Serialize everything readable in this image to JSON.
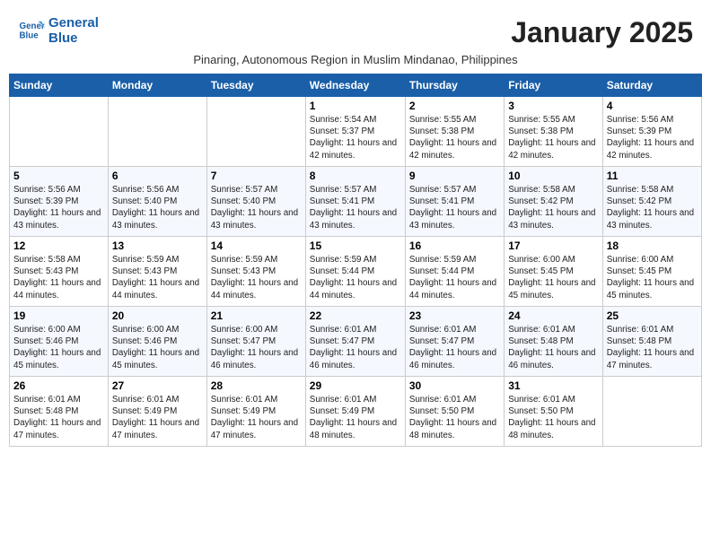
{
  "header": {
    "logo_line1": "General",
    "logo_line2": "Blue",
    "month_title": "January 2025",
    "subtitle": "Pinaring, Autonomous Region in Muslim Mindanao, Philippines"
  },
  "weekdays": [
    "Sunday",
    "Monday",
    "Tuesday",
    "Wednesday",
    "Thursday",
    "Friday",
    "Saturday"
  ],
  "weeks": [
    [
      {
        "day": "",
        "sunrise": "",
        "sunset": "",
        "daylight": ""
      },
      {
        "day": "",
        "sunrise": "",
        "sunset": "",
        "daylight": ""
      },
      {
        "day": "",
        "sunrise": "",
        "sunset": "",
        "daylight": ""
      },
      {
        "day": "1",
        "sunrise": "Sunrise: 5:54 AM",
        "sunset": "Sunset: 5:37 PM",
        "daylight": "Daylight: 11 hours and 42 minutes."
      },
      {
        "day": "2",
        "sunrise": "Sunrise: 5:55 AM",
        "sunset": "Sunset: 5:38 PM",
        "daylight": "Daylight: 11 hours and 42 minutes."
      },
      {
        "day": "3",
        "sunrise": "Sunrise: 5:55 AM",
        "sunset": "Sunset: 5:38 PM",
        "daylight": "Daylight: 11 hours and 42 minutes."
      },
      {
        "day": "4",
        "sunrise": "Sunrise: 5:56 AM",
        "sunset": "Sunset: 5:39 PM",
        "daylight": "Daylight: 11 hours and 42 minutes."
      }
    ],
    [
      {
        "day": "5",
        "sunrise": "Sunrise: 5:56 AM",
        "sunset": "Sunset: 5:39 PM",
        "daylight": "Daylight: 11 hours and 43 minutes."
      },
      {
        "day": "6",
        "sunrise": "Sunrise: 5:56 AM",
        "sunset": "Sunset: 5:40 PM",
        "daylight": "Daylight: 11 hours and 43 minutes."
      },
      {
        "day": "7",
        "sunrise": "Sunrise: 5:57 AM",
        "sunset": "Sunset: 5:40 PM",
        "daylight": "Daylight: 11 hours and 43 minutes."
      },
      {
        "day": "8",
        "sunrise": "Sunrise: 5:57 AM",
        "sunset": "Sunset: 5:41 PM",
        "daylight": "Daylight: 11 hours and 43 minutes."
      },
      {
        "day": "9",
        "sunrise": "Sunrise: 5:57 AM",
        "sunset": "Sunset: 5:41 PM",
        "daylight": "Daylight: 11 hours and 43 minutes."
      },
      {
        "day": "10",
        "sunrise": "Sunrise: 5:58 AM",
        "sunset": "Sunset: 5:42 PM",
        "daylight": "Daylight: 11 hours and 43 minutes."
      },
      {
        "day": "11",
        "sunrise": "Sunrise: 5:58 AM",
        "sunset": "Sunset: 5:42 PM",
        "daylight": "Daylight: 11 hours and 43 minutes."
      }
    ],
    [
      {
        "day": "12",
        "sunrise": "Sunrise: 5:58 AM",
        "sunset": "Sunset: 5:43 PM",
        "daylight": "Daylight: 11 hours and 44 minutes."
      },
      {
        "day": "13",
        "sunrise": "Sunrise: 5:59 AM",
        "sunset": "Sunset: 5:43 PM",
        "daylight": "Daylight: 11 hours and 44 minutes."
      },
      {
        "day": "14",
        "sunrise": "Sunrise: 5:59 AM",
        "sunset": "Sunset: 5:43 PM",
        "daylight": "Daylight: 11 hours and 44 minutes."
      },
      {
        "day": "15",
        "sunrise": "Sunrise: 5:59 AM",
        "sunset": "Sunset: 5:44 PM",
        "daylight": "Daylight: 11 hours and 44 minutes."
      },
      {
        "day": "16",
        "sunrise": "Sunrise: 5:59 AM",
        "sunset": "Sunset: 5:44 PM",
        "daylight": "Daylight: 11 hours and 44 minutes."
      },
      {
        "day": "17",
        "sunrise": "Sunrise: 6:00 AM",
        "sunset": "Sunset: 5:45 PM",
        "daylight": "Daylight: 11 hours and 45 minutes."
      },
      {
        "day": "18",
        "sunrise": "Sunrise: 6:00 AM",
        "sunset": "Sunset: 5:45 PM",
        "daylight": "Daylight: 11 hours and 45 minutes."
      }
    ],
    [
      {
        "day": "19",
        "sunrise": "Sunrise: 6:00 AM",
        "sunset": "Sunset: 5:46 PM",
        "daylight": "Daylight: 11 hours and 45 minutes."
      },
      {
        "day": "20",
        "sunrise": "Sunrise: 6:00 AM",
        "sunset": "Sunset: 5:46 PM",
        "daylight": "Daylight: 11 hours and 45 minutes."
      },
      {
        "day": "21",
        "sunrise": "Sunrise: 6:00 AM",
        "sunset": "Sunset: 5:47 PM",
        "daylight": "Daylight: 11 hours and 46 minutes."
      },
      {
        "day": "22",
        "sunrise": "Sunrise: 6:01 AM",
        "sunset": "Sunset: 5:47 PM",
        "daylight": "Daylight: 11 hours and 46 minutes."
      },
      {
        "day": "23",
        "sunrise": "Sunrise: 6:01 AM",
        "sunset": "Sunset: 5:47 PM",
        "daylight": "Daylight: 11 hours and 46 minutes."
      },
      {
        "day": "24",
        "sunrise": "Sunrise: 6:01 AM",
        "sunset": "Sunset: 5:48 PM",
        "daylight": "Daylight: 11 hours and 46 minutes."
      },
      {
        "day": "25",
        "sunrise": "Sunrise: 6:01 AM",
        "sunset": "Sunset: 5:48 PM",
        "daylight": "Daylight: 11 hours and 47 minutes."
      }
    ],
    [
      {
        "day": "26",
        "sunrise": "Sunrise: 6:01 AM",
        "sunset": "Sunset: 5:48 PM",
        "daylight": "Daylight: 11 hours and 47 minutes."
      },
      {
        "day": "27",
        "sunrise": "Sunrise: 6:01 AM",
        "sunset": "Sunset: 5:49 PM",
        "daylight": "Daylight: 11 hours and 47 minutes."
      },
      {
        "day": "28",
        "sunrise": "Sunrise: 6:01 AM",
        "sunset": "Sunset: 5:49 PM",
        "daylight": "Daylight: 11 hours and 47 minutes."
      },
      {
        "day": "29",
        "sunrise": "Sunrise: 6:01 AM",
        "sunset": "Sunset: 5:49 PM",
        "daylight": "Daylight: 11 hours and 48 minutes."
      },
      {
        "day": "30",
        "sunrise": "Sunrise: 6:01 AM",
        "sunset": "Sunset: 5:50 PM",
        "daylight": "Daylight: 11 hours and 48 minutes."
      },
      {
        "day": "31",
        "sunrise": "Sunrise: 6:01 AM",
        "sunset": "Sunset: 5:50 PM",
        "daylight": "Daylight: 11 hours and 48 minutes."
      },
      {
        "day": "",
        "sunrise": "",
        "sunset": "",
        "daylight": ""
      }
    ]
  ]
}
